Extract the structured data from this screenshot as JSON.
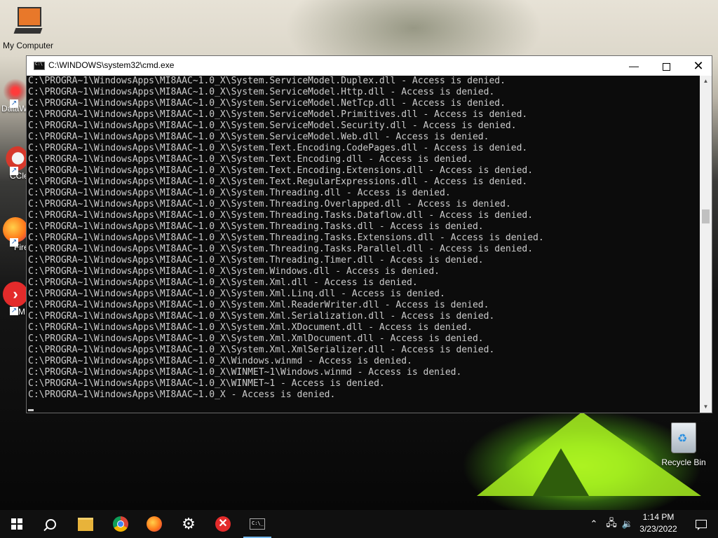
{
  "desktop": {
    "icons": [
      {
        "label": "My Computer"
      },
      {
        "label": "DataW"
      },
      {
        "label": "CCle"
      },
      {
        "label": "Fire"
      },
      {
        "label": "VMI"
      },
      {
        "label": "Recycle Bin"
      }
    ]
  },
  "cmd_window": {
    "title": "C:\\WINDOWS\\system32\\cmd.exe",
    "lines": [
      "C:\\PROGRA~1\\WindowsApps\\MI8AAC~1.0_X\\System.ServiceModel.Duplex.dll - Access is denied.",
      "C:\\PROGRA~1\\WindowsApps\\MI8AAC~1.0_X\\System.ServiceModel.Http.dll - Access is denied.",
      "C:\\PROGRA~1\\WindowsApps\\MI8AAC~1.0_X\\System.ServiceModel.NetTcp.dll - Access is denied.",
      "C:\\PROGRA~1\\WindowsApps\\MI8AAC~1.0_X\\System.ServiceModel.Primitives.dll - Access is denied.",
      "C:\\PROGRA~1\\WindowsApps\\MI8AAC~1.0_X\\System.ServiceModel.Security.dll - Access is denied.",
      "C:\\PROGRA~1\\WindowsApps\\MI8AAC~1.0_X\\System.ServiceModel.Web.dll - Access is denied.",
      "C:\\PROGRA~1\\WindowsApps\\MI8AAC~1.0_X\\System.Text.Encoding.CodePages.dll - Access is denied.",
      "C:\\PROGRA~1\\WindowsApps\\MI8AAC~1.0_X\\System.Text.Encoding.dll - Access is denied.",
      "C:\\PROGRA~1\\WindowsApps\\MI8AAC~1.0_X\\System.Text.Encoding.Extensions.dll - Access is denied.",
      "C:\\PROGRA~1\\WindowsApps\\MI8AAC~1.0_X\\System.Text.RegularExpressions.dll - Access is denied.",
      "C:\\PROGRA~1\\WindowsApps\\MI8AAC~1.0_X\\System.Threading.dll - Access is denied.",
      "C:\\PROGRA~1\\WindowsApps\\MI8AAC~1.0_X\\System.Threading.Overlapped.dll - Access is denied.",
      "C:\\PROGRA~1\\WindowsApps\\MI8AAC~1.0_X\\System.Threading.Tasks.Dataflow.dll - Access is denied.",
      "C:\\PROGRA~1\\WindowsApps\\MI8AAC~1.0_X\\System.Threading.Tasks.dll - Access is denied.",
      "C:\\PROGRA~1\\WindowsApps\\MI8AAC~1.0_X\\System.Threading.Tasks.Extensions.dll - Access is denied.",
      "C:\\PROGRA~1\\WindowsApps\\MI8AAC~1.0_X\\System.Threading.Tasks.Parallel.dll - Access is denied.",
      "C:\\PROGRA~1\\WindowsApps\\MI8AAC~1.0_X\\System.Threading.Timer.dll - Access is denied.",
      "C:\\PROGRA~1\\WindowsApps\\MI8AAC~1.0_X\\System.Windows.dll - Access is denied.",
      "C:\\PROGRA~1\\WindowsApps\\MI8AAC~1.0_X\\System.Xml.dll - Access is denied.",
      "C:\\PROGRA~1\\WindowsApps\\MI8AAC~1.0_X\\System.Xml.Linq.dll - Access is denied.",
      "C:\\PROGRA~1\\WindowsApps\\MI8AAC~1.0_X\\System.Xml.ReaderWriter.dll - Access is denied.",
      "C:\\PROGRA~1\\WindowsApps\\MI8AAC~1.0_X\\System.Xml.Serialization.dll - Access is denied.",
      "C:\\PROGRA~1\\WindowsApps\\MI8AAC~1.0_X\\System.Xml.XDocument.dll - Access is denied.",
      "C:\\PROGRA~1\\WindowsApps\\MI8AAC~1.0_X\\System.Xml.XmlDocument.dll - Access is denied.",
      "C:\\PROGRA~1\\WindowsApps\\MI8AAC~1.0_X\\System.Xml.XmlSerializer.dll - Access is denied.",
      "C:\\PROGRA~1\\WindowsApps\\MI8AAC~1.0_X\\Windows.winmd - Access is denied.",
      "C:\\PROGRA~1\\WindowsApps\\MI8AAC~1.0_X\\WINMET~1\\Windows.winmd - Access is denied.",
      "C:\\PROGRA~1\\WindowsApps\\MI8AAC~1.0_X\\WINMET~1 - Access is denied.",
      "C:\\PROGRA~1\\WindowsApps\\MI8AAC~1.0_X - Access is denied."
    ]
  },
  "taskbar": {
    "clock_time": "1:14 PM",
    "clock_date": "3/23/2022",
    "items": [
      "start",
      "search",
      "file-explorer",
      "chrome",
      "firefox",
      "settings",
      "x-app",
      "command-prompt"
    ]
  },
  "colors": {
    "console_bg": "#0c0c0c",
    "console_text": "#cccccc",
    "taskbar_bg": "#101010",
    "active_indicator": "#76b9ed"
  }
}
